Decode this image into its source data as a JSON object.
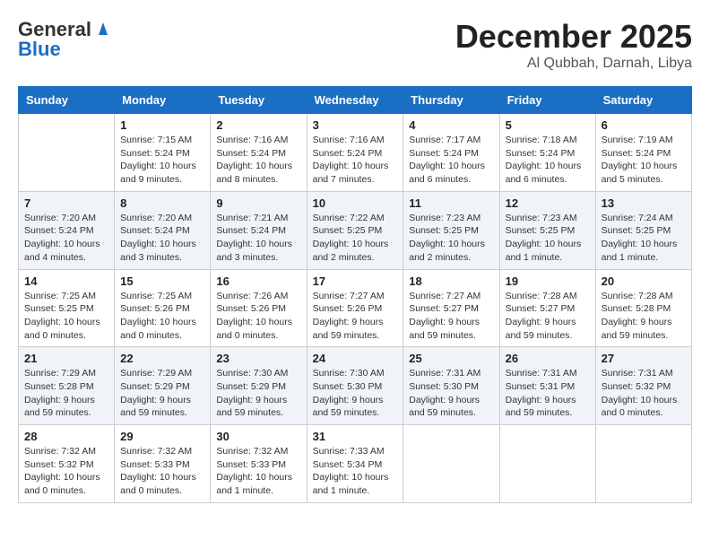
{
  "logo": {
    "line1": "General",
    "line2": "Blue"
  },
  "title": "December 2025",
  "location": "Al Qubbah, Darnah, Libya",
  "weekdays": [
    "Sunday",
    "Monday",
    "Tuesday",
    "Wednesday",
    "Thursday",
    "Friday",
    "Saturday"
  ],
  "weeks": [
    [
      {
        "day": "",
        "sunrise": "",
        "sunset": "",
        "daylight": ""
      },
      {
        "day": "1",
        "sunrise": "Sunrise: 7:15 AM",
        "sunset": "Sunset: 5:24 PM",
        "daylight": "Daylight: 10 hours and 9 minutes."
      },
      {
        "day": "2",
        "sunrise": "Sunrise: 7:16 AM",
        "sunset": "Sunset: 5:24 PM",
        "daylight": "Daylight: 10 hours and 8 minutes."
      },
      {
        "day": "3",
        "sunrise": "Sunrise: 7:16 AM",
        "sunset": "Sunset: 5:24 PM",
        "daylight": "Daylight: 10 hours and 7 minutes."
      },
      {
        "day": "4",
        "sunrise": "Sunrise: 7:17 AM",
        "sunset": "Sunset: 5:24 PM",
        "daylight": "Daylight: 10 hours and 6 minutes."
      },
      {
        "day": "5",
        "sunrise": "Sunrise: 7:18 AM",
        "sunset": "Sunset: 5:24 PM",
        "daylight": "Daylight: 10 hours and 6 minutes."
      },
      {
        "day": "6",
        "sunrise": "Sunrise: 7:19 AM",
        "sunset": "Sunset: 5:24 PM",
        "daylight": "Daylight: 10 hours and 5 minutes."
      }
    ],
    [
      {
        "day": "7",
        "sunrise": "Sunrise: 7:20 AM",
        "sunset": "Sunset: 5:24 PM",
        "daylight": "Daylight: 10 hours and 4 minutes."
      },
      {
        "day": "8",
        "sunrise": "Sunrise: 7:20 AM",
        "sunset": "Sunset: 5:24 PM",
        "daylight": "Daylight: 10 hours and 3 minutes."
      },
      {
        "day": "9",
        "sunrise": "Sunrise: 7:21 AM",
        "sunset": "Sunset: 5:24 PM",
        "daylight": "Daylight: 10 hours and 3 minutes."
      },
      {
        "day": "10",
        "sunrise": "Sunrise: 7:22 AM",
        "sunset": "Sunset: 5:25 PM",
        "daylight": "Daylight: 10 hours and 2 minutes."
      },
      {
        "day": "11",
        "sunrise": "Sunrise: 7:23 AM",
        "sunset": "Sunset: 5:25 PM",
        "daylight": "Daylight: 10 hours and 2 minutes."
      },
      {
        "day": "12",
        "sunrise": "Sunrise: 7:23 AM",
        "sunset": "Sunset: 5:25 PM",
        "daylight": "Daylight: 10 hours and 1 minute."
      },
      {
        "day": "13",
        "sunrise": "Sunrise: 7:24 AM",
        "sunset": "Sunset: 5:25 PM",
        "daylight": "Daylight: 10 hours and 1 minute."
      }
    ],
    [
      {
        "day": "14",
        "sunrise": "Sunrise: 7:25 AM",
        "sunset": "Sunset: 5:25 PM",
        "daylight": "Daylight: 10 hours and 0 minutes."
      },
      {
        "day": "15",
        "sunrise": "Sunrise: 7:25 AM",
        "sunset": "Sunset: 5:26 PM",
        "daylight": "Daylight: 10 hours and 0 minutes."
      },
      {
        "day": "16",
        "sunrise": "Sunrise: 7:26 AM",
        "sunset": "Sunset: 5:26 PM",
        "daylight": "Daylight: 10 hours and 0 minutes."
      },
      {
        "day": "17",
        "sunrise": "Sunrise: 7:27 AM",
        "sunset": "Sunset: 5:26 PM",
        "daylight": "Daylight: 9 hours and 59 minutes."
      },
      {
        "day": "18",
        "sunrise": "Sunrise: 7:27 AM",
        "sunset": "Sunset: 5:27 PM",
        "daylight": "Daylight: 9 hours and 59 minutes."
      },
      {
        "day": "19",
        "sunrise": "Sunrise: 7:28 AM",
        "sunset": "Sunset: 5:27 PM",
        "daylight": "Daylight: 9 hours and 59 minutes."
      },
      {
        "day": "20",
        "sunrise": "Sunrise: 7:28 AM",
        "sunset": "Sunset: 5:28 PM",
        "daylight": "Daylight: 9 hours and 59 minutes."
      }
    ],
    [
      {
        "day": "21",
        "sunrise": "Sunrise: 7:29 AM",
        "sunset": "Sunset: 5:28 PM",
        "daylight": "Daylight: 9 hours and 59 minutes."
      },
      {
        "day": "22",
        "sunrise": "Sunrise: 7:29 AM",
        "sunset": "Sunset: 5:29 PM",
        "daylight": "Daylight: 9 hours and 59 minutes."
      },
      {
        "day": "23",
        "sunrise": "Sunrise: 7:30 AM",
        "sunset": "Sunset: 5:29 PM",
        "daylight": "Daylight: 9 hours and 59 minutes."
      },
      {
        "day": "24",
        "sunrise": "Sunrise: 7:30 AM",
        "sunset": "Sunset: 5:30 PM",
        "daylight": "Daylight: 9 hours and 59 minutes."
      },
      {
        "day": "25",
        "sunrise": "Sunrise: 7:31 AM",
        "sunset": "Sunset: 5:30 PM",
        "daylight": "Daylight: 9 hours and 59 minutes."
      },
      {
        "day": "26",
        "sunrise": "Sunrise: 7:31 AM",
        "sunset": "Sunset: 5:31 PM",
        "daylight": "Daylight: 9 hours and 59 minutes."
      },
      {
        "day": "27",
        "sunrise": "Sunrise: 7:31 AM",
        "sunset": "Sunset: 5:32 PM",
        "daylight": "Daylight: 10 hours and 0 minutes."
      }
    ],
    [
      {
        "day": "28",
        "sunrise": "Sunrise: 7:32 AM",
        "sunset": "Sunset: 5:32 PM",
        "daylight": "Daylight: 10 hours and 0 minutes."
      },
      {
        "day": "29",
        "sunrise": "Sunrise: 7:32 AM",
        "sunset": "Sunset: 5:33 PM",
        "daylight": "Daylight: 10 hours and 0 minutes."
      },
      {
        "day": "30",
        "sunrise": "Sunrise: 7:32 AM",
        "sunset": "Sunset: 5:33 PM",
        "daylight": "Daylight: 10 hours and 1 minute."
      },
      {
        "day": "31",
        "sunrise": "Sunrise: 7:33 AM",
        "sunset": "Sunset: 5:34 PM",
        "daylight": "Daylight: 10 hours and 1 minute."
      },
      {
        "day": "",
        "sunrise": "",
        "sunset": "",
        "daylight": ""
      },
      {
        "day": "",
        "sunrise": "",
        "sunset": "",
        "daylight": ""
      },
      {
        "day": "",
        "sunrise": "",
        "sunset": "",
        "daylight": ""
      }
    ]
  ]
}
